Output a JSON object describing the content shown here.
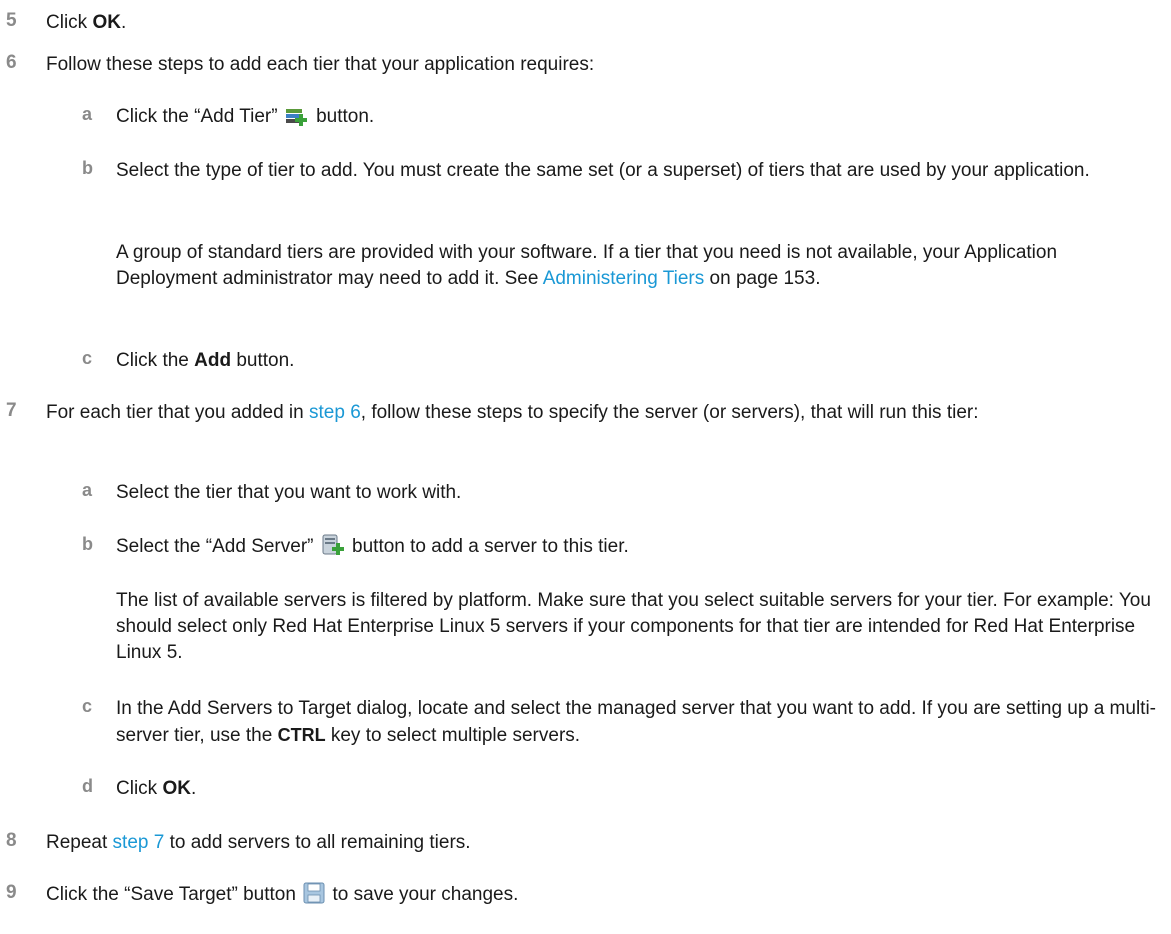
{
  "step5": {
    "num": "5",
    "pre": "Click ",
    "bold": "OK",
    "post": "."
  },
  "step6": {
    "num": "6",
    "text": "Follow these steps to add each tier that your application requires:",
    "a": {
      "letter": "a",
      "pre": "Click the “Add Tier”",
      "post": " button.",
      "icon": "add-tier-icon"
    },
    "b": {
      "letter": "b",
      "text": "Select the type of tier to add. You must create the same set (or a superset) of tiers that are used by your application.",
      "para_pre": "A group of standard tiers are provided with your software. If a tier that you need is not available, your Application Deployment administrator may need to add it. See ",
      "para_link": "Administering Tiers",
      "para_post": " on page 153."
    },
    "c": {
      "letter": "c",
      "pre": "Click the ",
      "bold": "Add",
      "post": " button."
    }
  },
  "step7": {
    "num": "7",
    "pre": "For each tier that you added in ",
    "link": "step 6",
    "post": ", follow these steps to specify the server (or servers), that will run this tier:",
    "a": {
      "letter": "a",
      "text": "Select the tier that you want to work with."
    },
    "b": {
      "letter": "b",
      "pre": "Select the “Add Server”",
      "post": " button to add a server to this tier.",
      "icon": "add-server-icon",
      "para": "The list of available servers is filtered by platform. Make sure that you select suitable servers for your tier. For example: You should select only Red Hat Enterprise Linux 5 servers if your components for that tier are intended for Red Hat Enterprise Linux 5."
    },
    "c": {
      "letter": "c",
      "pre": "In the Add Servers to Target dialog, locate and select the managed server that you want to add. If you are setting up a multi-server tier, use the ",
      "bold": "CTRL",
      "post": " key to select multiple servers."
    },
    "d": {
      "letter": "d",
      "pre": "Click ",
      "bold": "OK",
      "post": "."
    }
  },
  "step8": {
    "num": "8",
    "pre": "Repeat ",
    "link": "step 7",
    "post": " to add servers to all remaining tiers."
  },
  "step9": {
    "num": "9",
    "pre": "Click the “Save Target” button",
    "post": " to save your changes.",
    "icon": "save-target-icon"
  }
}
